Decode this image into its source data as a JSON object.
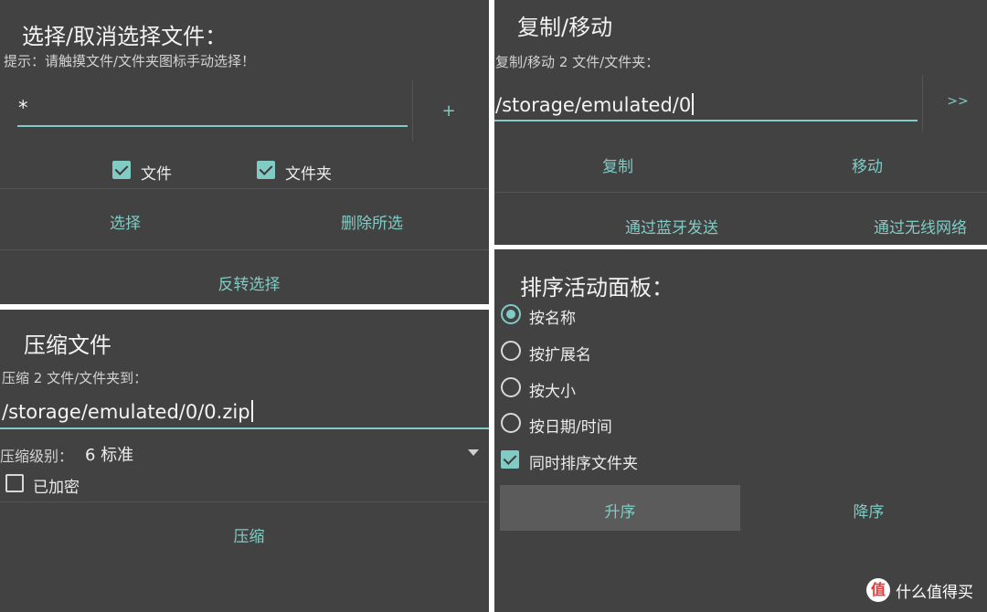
{
  "select_panel": {
    "title": "选择/取消选择文件：",
    "hint": "提示：请触摸文件/文件夹图标手动选择！",
    "pattern_value": "*",
    "add_label": "+",
    "file_checkbox_label": "文件",
    "folder_checkbox_label": "文件夹",
    "select_label": "选择",
    "delete_selected_label": "删除所选",
    "invert_label": "反转选择"
  },
  "copy_panel": {
    "title": "复制/移动",
    "hint": "复制/移动 2 文件/文件夹：",
    "path_value": "/storage/emulated/0",
    "browse_label": ">>",
    "copy_label": "复制",
    "move_label": "移动",
    "bluetooth_label": "通过蓝牙发送",
    "wifi_label": "通过无线网络"
  },
  "zip_panel": {
    "title": "压缩文件",
    "hint": "压缩 2 文件/文件夹到：",
    "path_value": "/storage/emulated/0/0.zip",
    "level_label": "压缩级别：",
    "level_value": "6 标准",
    "encrypt_label": "已加密",
    "zip_label": "压缩"
  },
  "sort_panel": {
    "title": "排序活动面板：",
    "options": [
      "按名称",
      "按扩展名",
      "按大小",
      "按日期/时间"
    ],
    "selected_index": 0,
    "sort_folders_label": "同时排序文件夹",
    "ascending_label": "升序",
    "descending_label": "降序"
  },
  "watermark": {
    "logo_text": "值",
    "text": "什么值得买"
  },
  "colors": {
    "panel_bg": "#424242",
    "accent": "#80cbc4",
    "divider": "#555555",
    "gutter": "#ffffff"
  }
}
